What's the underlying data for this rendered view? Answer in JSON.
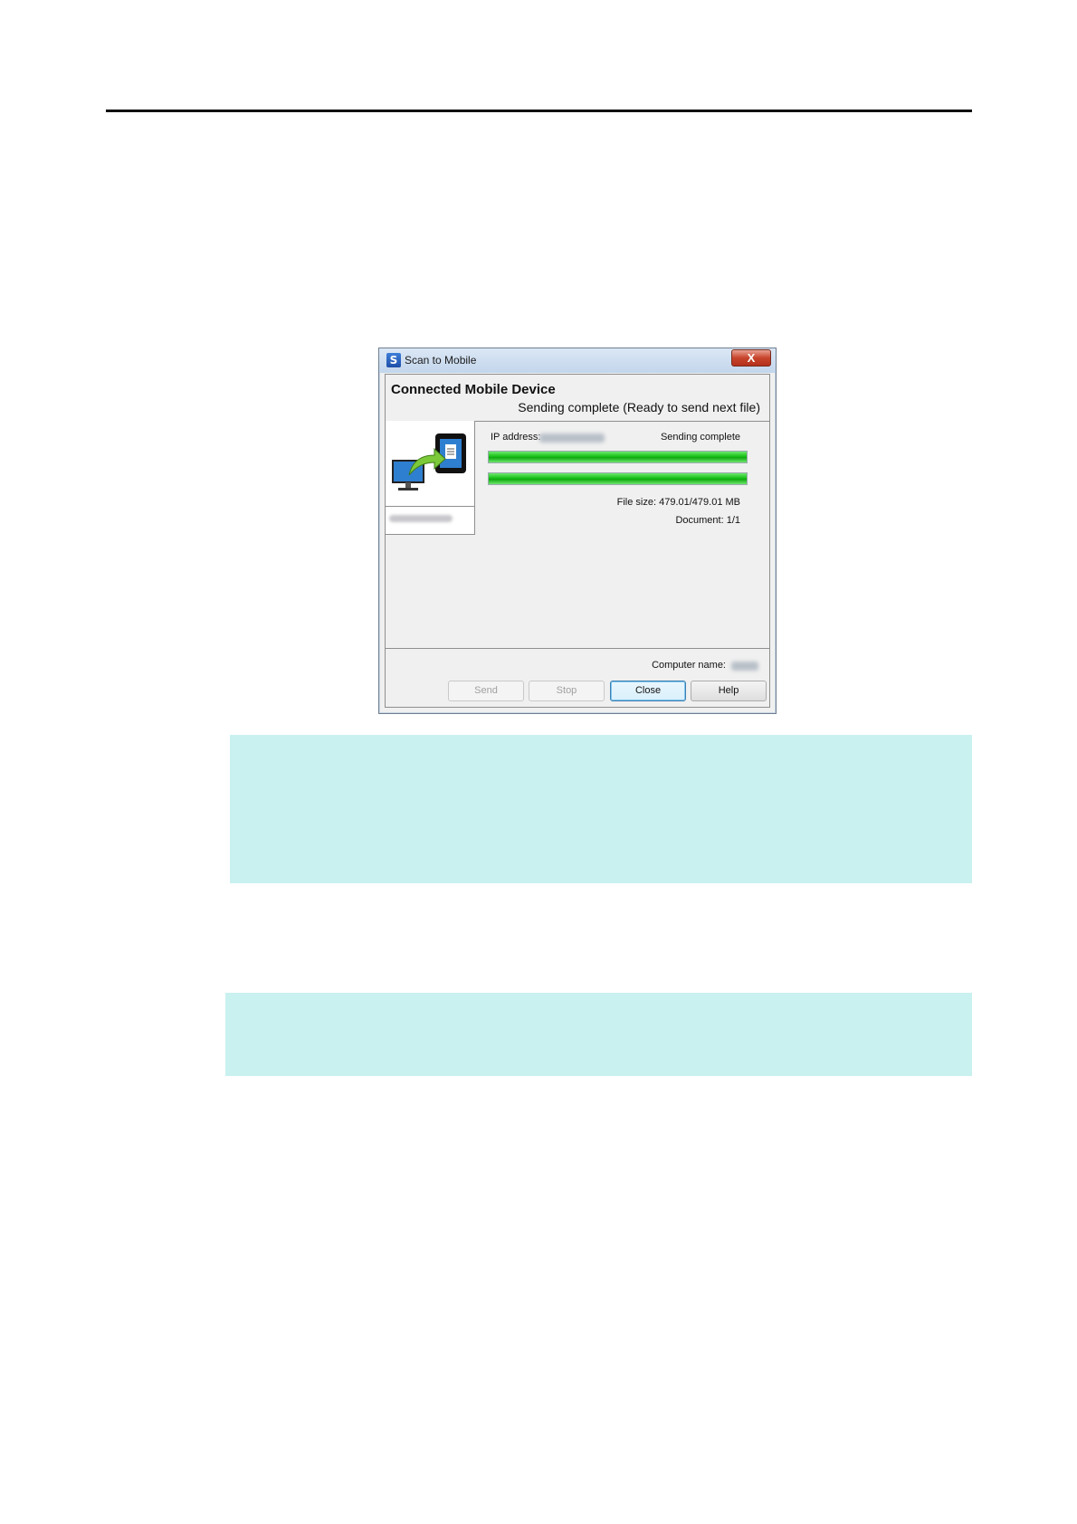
{
  "window": {
    "title": "Scan to Mobile",
    "close_glyph": "X",
    "app_icon": "S"
  },
  "header": {
    "title": "Connected Mobile Device",
    "status": "Sending complete (Ready to send next file)"
  },
  "device": {
    "icon": "computer-to-mobile-icon"
  },
  "transfer": {
    "ip_label": "IP address:",
    "status": "Sending complete",
    "progress_1": 1.0,
    "progress_2": 1.0,
    "file_size": "File size: 479.01/479.01 MB",
    "document": "Document: 1/1"
  },
  "footer": {
    "computer_name_label": "Computer name:"
  },
  "buttons": {
    "send": "Send",
    "stop": "Stop",
    "close": "Close",
    "help": "Help"
  },
  "colors": {
    "progress": "#18c018",
    "note_background": "#c9f1f0"
  }
}
